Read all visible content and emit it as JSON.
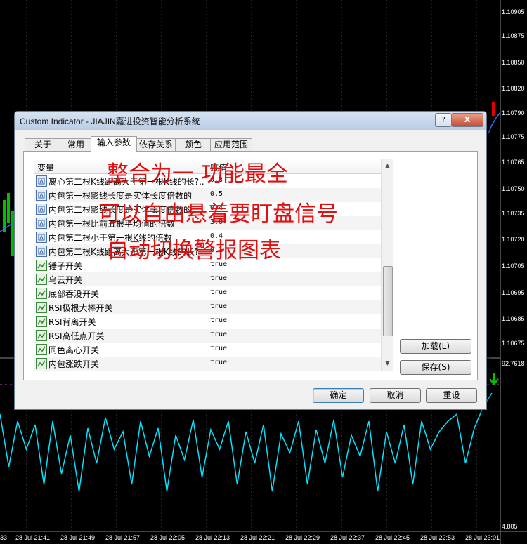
{
  "chart": {
    "price_labels": [
      "1.10905",
      "1.10875",
      "1.10850",
      "1.10820",
      "1.10790",
      "1.10775",
      "1.10765",
      "1.10750",
      "1.10735",
      "1.10720",
      "1.10705",
      "1.10695",
      "1.10685",
      "1.10675"
    ],
    "indicator_value": "92.7618",
    "bottom_value": "4.805",
    "time_labels": [
      "28 Jul 21:41",
      "28 Jul 21:49",
      "28 Jul 21:57",
      "28 Jul 22:05",
      "28 Jul 22:13",
      "28 Jul 22:21",
      "28 Jul 22:29",
      "28 Jul 22:37",
      "28 Jul 22:45",
      "28 Jul 22:53",
      "28 Jul 23:01"
    ],
    "first_time_label": "33",
    "indicator_color": "#00e5ff",
    "arrow_color": "#00c000"
  },
  "dialog": {
    "title": "Custom Indicator - JIAJIN嘉进投资智能分析系统",
    "help_label": "?",
    "close_label": "X",
    "tabs": [
      "关于",
      "常用",
      "输入参数",
      "依存关系",
      "颜色",
      "应用范围"
    ],
    "active_tab": "输入参数",
    "list": {
      "header_variable": "变量",
      "header_value": "赋值",
      "rows": [
        {
          "icon": "number-icon",
          "name": "离心第二根K线距离大于第一根K线的长?..",
          "value": "0.3"
        },
        {
          "icon": "number-icon",
          "name": "内包第一根影线长度是实体长度倍数的",
          "value": "0.5"
        },
        {
          "icon": "number-icon",
          "name": "内包第二根影线长度是实体长度倍数的",
          "value": "0.4"
        },
        {
          "icon": "number-icon",
          "name": "内包第一根比前五根平均值的倍数",
          "value": "3.0"
        },
        {
          "icon": "number-icon",
          "name": "内包第二根小于第一根K线的倍数",
          "value": "0.4"
        },
        {
          "icon": "number-icon",
          "name": "内包第二根K线距离大于第一根K线的长?",
          "value": "0.1"
        },
        {
          "icon": "bool-icon",
          "name": "锤子开关",
          "value": "true"
        },
        {
          "icon": "bool-icon",
          "name": "乌云开关",
          "value": "true"
        },
        {
          "icon": "bool-icon",
          "name": "底部吞没开关",
          "value": "true"
        },
        {
          "icon": "bool-icon",
          "name": "RSI极根大棒开关",
          "value": "true"
        },
        {
          "icon": "bool-icon",
          "name": "RSI背离开关",
          "value": "true"
        },
        {
          "icon": "bool-icon",
          "name": "RSI高低点开关",
          "value": "true"
        },
        {
          "icon": "bool-icon",
          "name": "同色离心开关",
          "value": "true"
        },
        {
          "icon": "bool-icon",
          "name": "内包涨跌开关",
          "value": "true"
        }
      ]
    },
    "load_label": "加载(L)",
    "save_label": "保存(S)",
    "ok_label": "确定",
    "cancel_label": "取消",
    "reset_label": "重设"
  },
  "overlay": {
    "line1": "整合为一 功能最全",
    "line2": "可以自由悬着要盯盘信号",
    "line3": "自动切换警报图表",
    "color": "#e01010"
  }
}
